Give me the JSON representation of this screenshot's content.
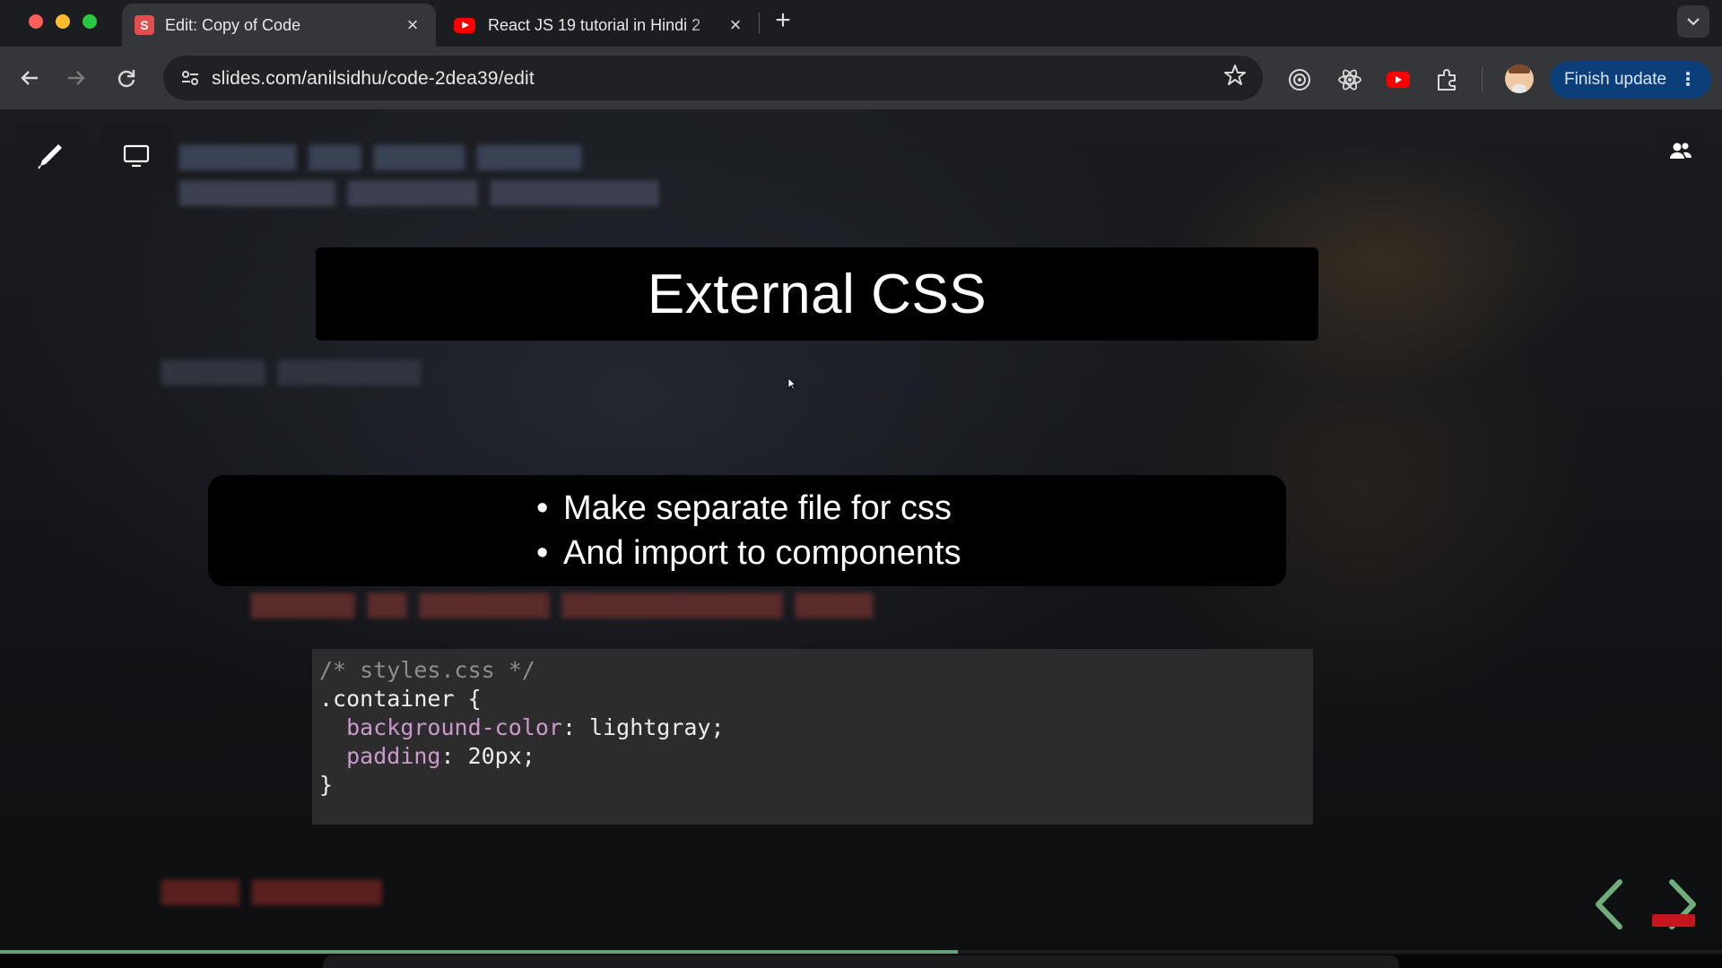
{
  "browser": {
    "tabs": [
      {
        "title": "Edit: Copy of Code",
        "favicon": "slides-s-icon",
        "favicon_letter": "S",
        "active": true
      },
      {
        "title": "React JS 19 tutorial in Hindi 2",
        "favicon": "youtube-icon",
        "active": false
      }
    ],
    "url": "slides.com/anilsidhu/code-2dea39/edit",
    "finish_update_label": "Finish update",
    "accent_color": "#0c3f7a"
  },
  "slide": {
    "title": "External CSS",
    "bullets": [
      "Make separate file for css",
      "And import to components"
    ],
    "code": {
      "comment": "/* styles.css */",
      "selector_open": ".container {",
      "prop1": "background-color",
      "val1": ": lightgray;",
      "prop2": "padding",
      "val2": ": 20px;",
      "close": "}"
    }
  },
  "presentation": {
    "progress_percent": 55.6
  }
}
